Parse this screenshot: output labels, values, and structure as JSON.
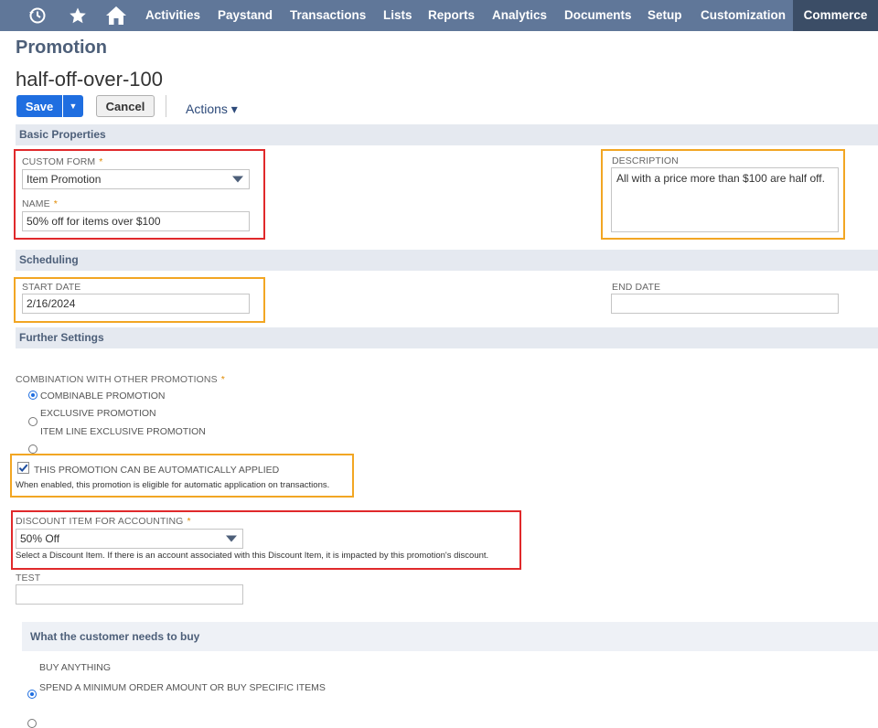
{
  "nav": {
    "items": [
      "Activities",
      "Paystand",
      "Transactions",
      "Lists",
      "Reports",
      "Analytics",
      "Documents",
      "Setup",
      "Customization",
      "Commerce"
    ],
    "active": "Commerce"
  },
  "page": {
    "title": "Promotion",
    "record_name": "half-off-over-100"
  },
  "toolbar": {
    "save_label": "Save",
    "cancel_label": "Cancel",
    "actions_label": "Actions ▾"
  },
  "basic": {
    "header": "Basic Properties",
    "custom_form_label": "CUSTOM FORM",
    "custom_form_value": "Item Promotion",
    "name_label": "NAME",
    "name_value": "50% off for items over $100",
    "description_label": "DESCRIPTION",
    "description_value": "All with a price more than $100 are half off.",
    "required_mark": "*"
  },
  "scheduling": {
    "header": "Scheduling",
    "start_label": "START DATE",
    "start_value": "2/16/2024",
    "end_label": "END DATE",
    "end_value": ""
  },
  "further": {
    "header": "Further Settings",
    "combination_label": "COMBINATION WITH OTHER PROMOTIONS",
    "options": [
      "COMBINABLE PROMOTION",
      "EXCLUSIVE PROMOTION",
      "ITEM LINE EXCLUSIVE PROMOTION"
    ],
    "selected": "COMBINABLE PROMOTION",
    "auto_apply_label": "THIS PROMOTION CAN BE AUTOMATICALLY APPLIED",
    "auto_apply_checked": true,
    "auto_apply_help": "When enabled, this promotion is eligible for automatic application on transactions.",
    "discount_label": "DISCOUNT ITEM FOR ACCOUNTING",
    "discount_value": "50% Off",
    "discount_help": "Select a Discount Item. If there is an account associated with this Discount Item, it is impacted by this promotion's discount.",
    "test_label": "TEST",
    "test_value": ""
  },
  "buy": {
    "header": "What the customer needs to buy",
    "options": [
      "BUY ANYTHING",
      "SPEND A MINIMUM ORDER AMOUNT OR BUY SPECIFIC ITEMS"
    ],
    "selected": "BUY ANYTHING"
  },
  "colors": {
    "nav_bg": "#607799",
    "nav_active": "#3b4d66",
    "primary": "#1f6ee0",
    "highlight_red": "#e0292b",
    "highlight_orange": "#f2a623"
  }
}
